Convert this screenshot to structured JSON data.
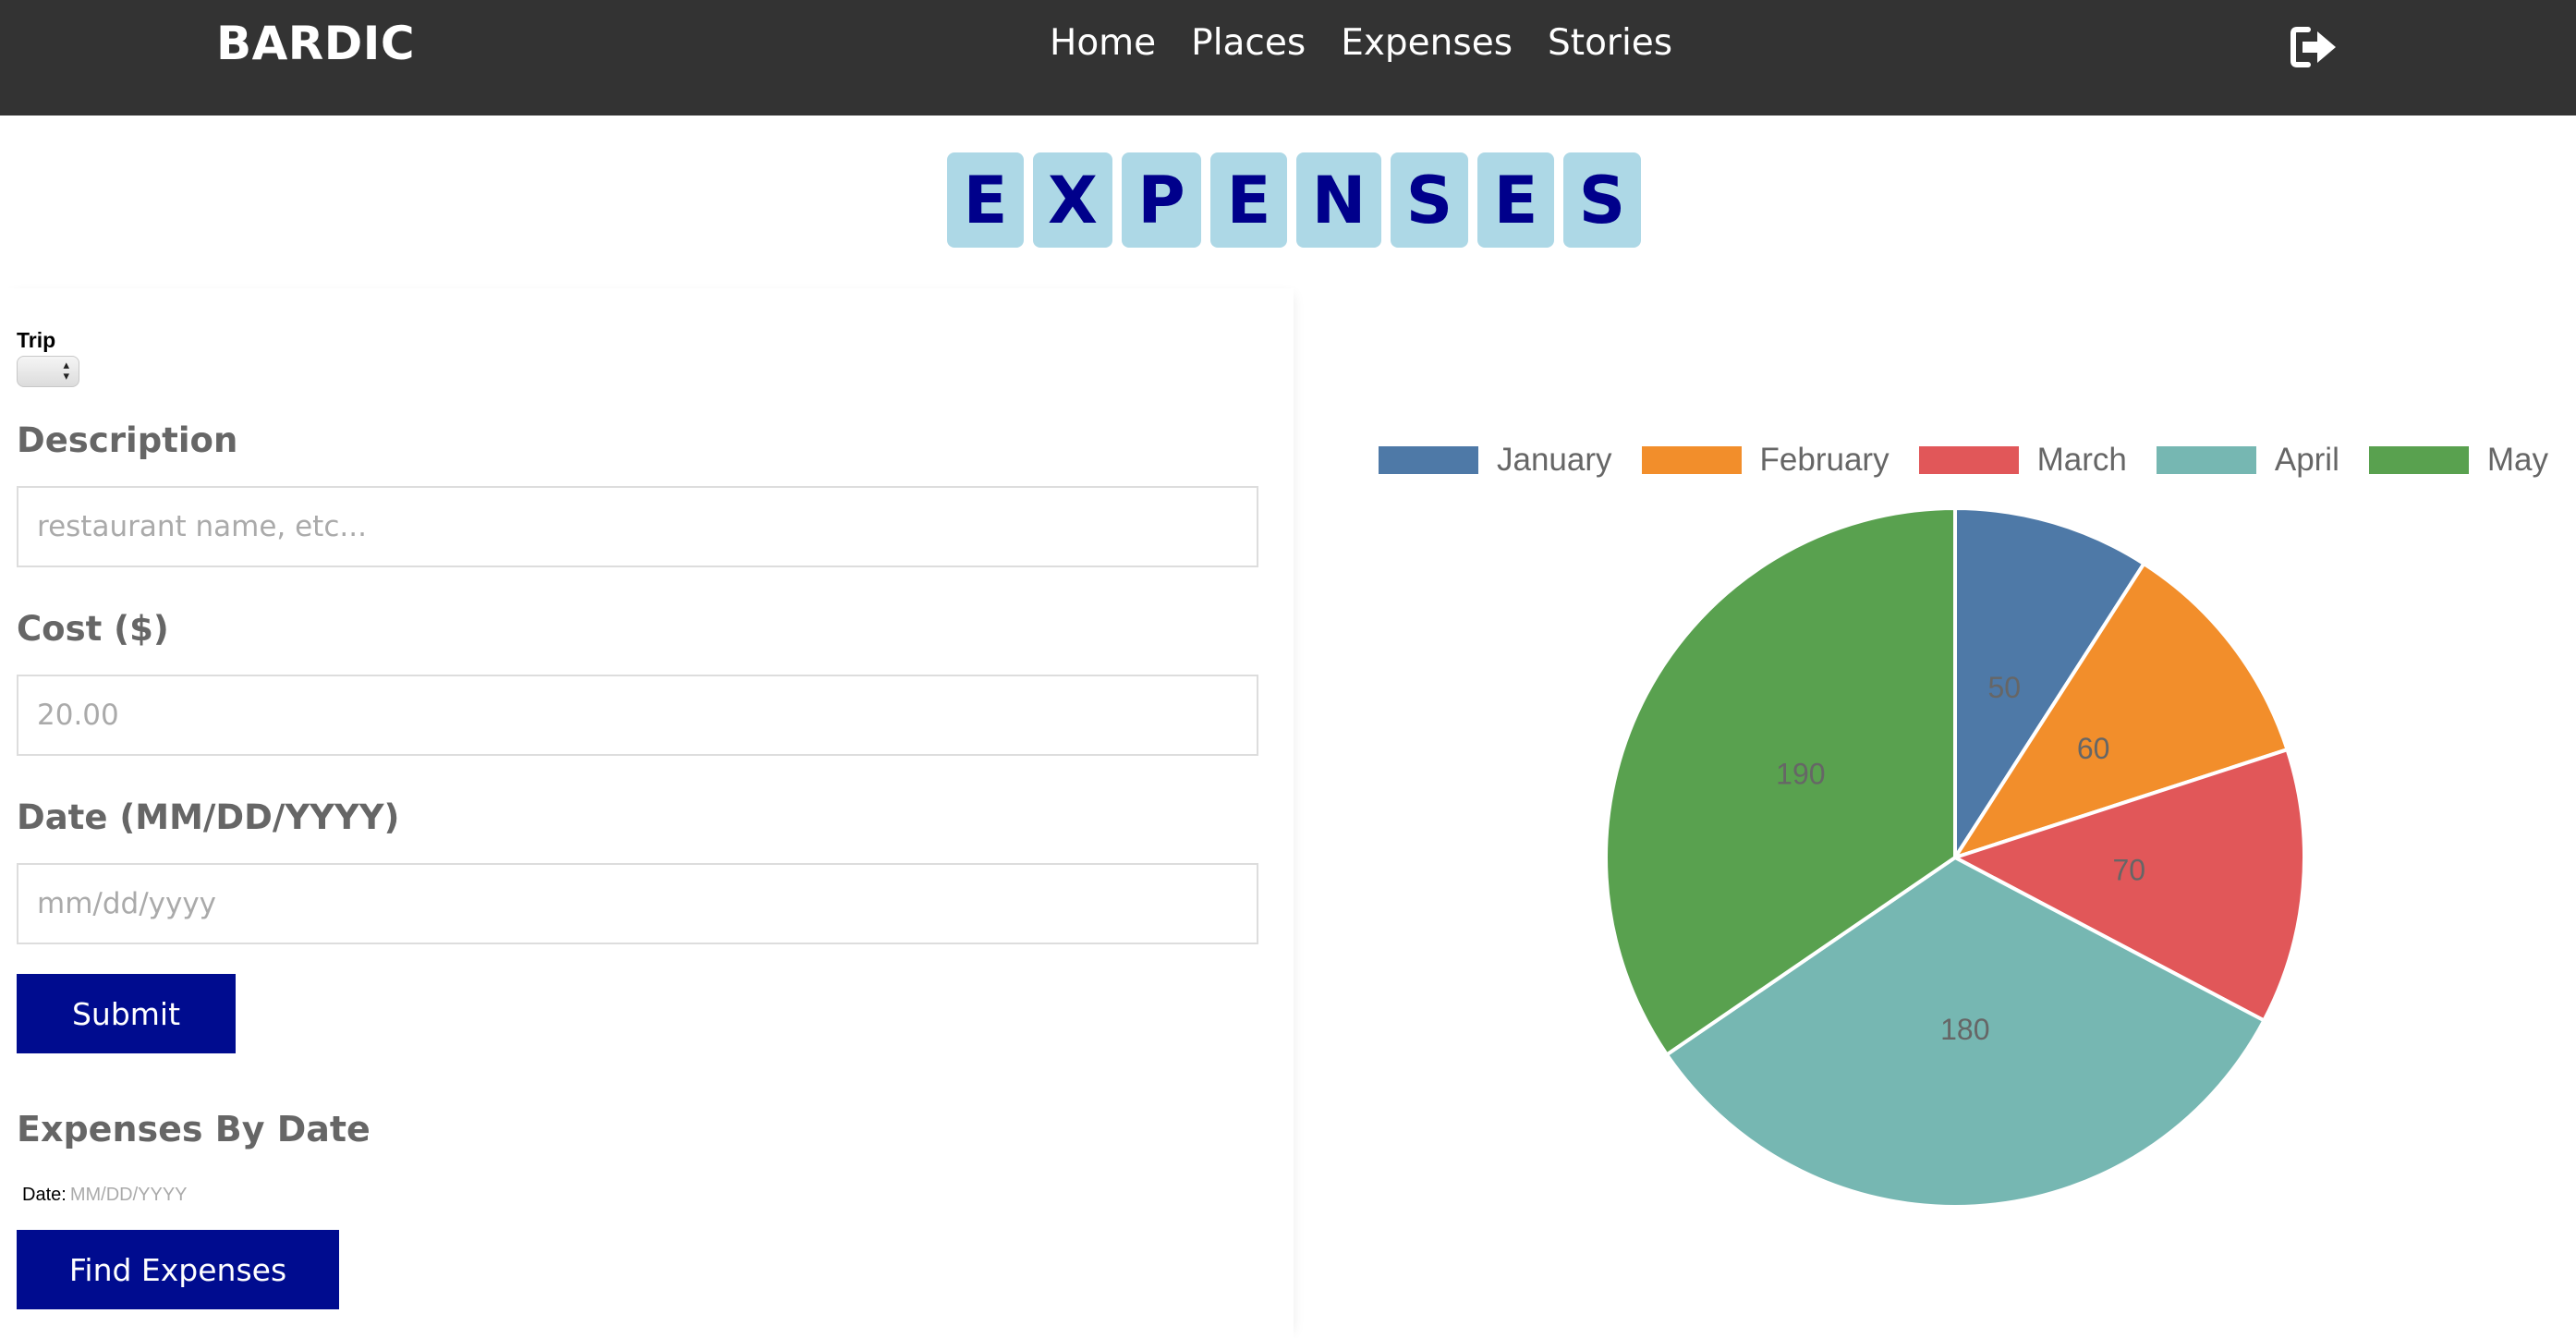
{
  "navbar": {
    "brand": "BARDIC",
    "links": [
      "Home",
      "Places",
      "Expenses",
      "Stories"
    ],
    "logout_icon": "sign-out-icon"
  },
  "page_title_letters": [
    "E",
    "X",
    "P",
    "E",
    "N",
    "S",
    "E",
    "S"
  ],
  "form": {
    "trip_label": "Trip",
    "trip_selected": "",
    "description_label": "Description",
    "description_placeholder": "restaurant name, etc...",
    "cost_label": "Cost ($)",
    "cost_placeholder": "20.00",
    "date_label": "Date (MM/DD/YYYY)",
    "date_placeholder": "mm/dd/yyyy",
    "submit_label": "Submit"
  },
  "expenses_by_date": {
    "title": "Expenses By Date",
    "date_label": "Date:",
    "date_placeholder": "MM/DD/YYYY",
    "button_label": "Find Expenses"
  },
  "colors": {
    "navbar": "#333333",
    "tile_bg": "#add8e6",
    "tile_text": "#00008b",
    "button": "#000c8f"
  },
  "chart_data": {
    "type": "pie",
    "legend_position": "top",
    "categories": [
      "January",
      "February",
      "March",
      "April",
      "May"
    ],
    "values": [
      50,
      60,
      70,
      180,
      190
    ],
    "colors": [
      "#4e79a7",
      "#f28e2b",
      "#e15759",
      "#76b7b2",
      "#59a14f"
    ],
    "data_labels_shown": true
  }
}
